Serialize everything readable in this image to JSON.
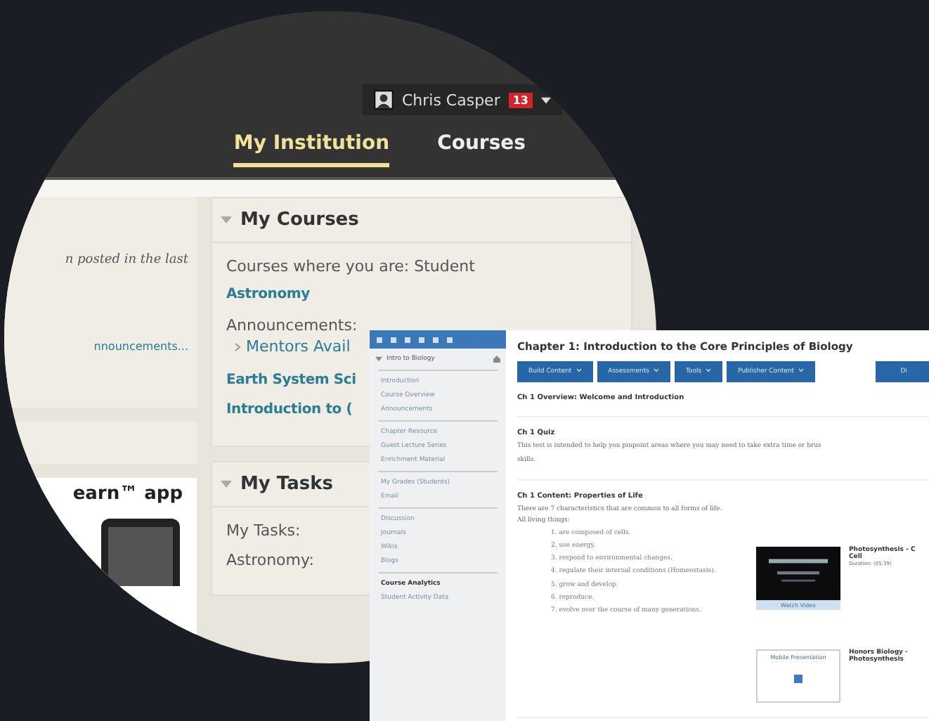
{
  "portal": {
    "user": {
      "name": "Chris Casper",
      "notifications": "13"
    },
    "tabs": [
      {
        "label": "My Institution",
        "selected": true
      },
      {
        "label": "Courses",
        "selected": false
      }
    ],
    "left_column": {
      "notice": "n posted in the last",
      "announcements_link": "nnouncements...",
      "app_promo": "earn™ app"
    },
    "my_courses": {
      "title": "My Courses",
      "expanded": true,
      "role_line": "Courses where you are: Student",
      "courses": [
        {
          "name": "Astronomy",
          "announcements_label": "Announcements:",
          "announcements": [
            "Mentors Avail"
          ]
        },
        {
          "name": "Earth System Sci"
        },
        {
          "name": "Introduction to ("
        }
      ]
    },
    "my_tasks": {
      "title": "My Tasks",
      "expanded": true,
      "lines": [
        "My Tasks:",
        "Astronomy:"
      ]
    }
  },
  "course_window": {
    "sidebar": {
      "course_title": "Intro to Biology",
      "sections": [
        {
          "items": [
            "Introduction",
            "Course Overview",
            "Announcements"
          ]
        },
        {
          "items": [
            "Chapter Resource",
            "Guest Lecture Series",
            "Enrichment Material"
          ]
        },
        {
          "items": [
            "My Grades (Students)",
            "Email"
          ]
        },
        {
          "items": [
            "Discussion",
            "Journals",
            "Wikis",
            "Blogs"
          ]
        },
        {
          "heading": "Course Analytics",
          "items": [
            "Student Activity Data"
          ]
        }
      ]
    },
    "title": "Chapter 1: Introduction to the Core Principles of Biology",
    "buttons": [
      "Build Content",
      "Assessments",
      "Tools",
      "Publisher Content"
    ],
    "edge_button": "Di",
    "items": [
      {
        "kind": "heading",
        "title": "Ch 1 Overview: Welcome and Introduction"
      },
      {
        "kind": "text",
        "title": "Ch 1 Quiz",
        "lines": [
          "This test is intended to help you pinpoint areas where you may need to take extra time or brus",
          "skills."
        ]
      },
      {
        "kind": "lesson",
        "title": "Ch 1 Content: Properties of Life",
        "intro": "There are 7 characteristics that are common to all forms of life. All living things:",
        "list": [
          "1. are composed of cells.",
          "2. use energy.",
          "3. respond to environmental changes.",
          "4. regulate their internal conditions (Homeostasis).",
          "5. grow and develop.",
          "6. reproduce.",
          "7. evolve over the course of many generations."
        ],
        "media": [
          {
            "kind": "video",
            "action": "Watch Video",
            "lines": [
              "Photosynthesis - C",
              "Cell",
              "Duration: (05:39)"
            ]
          },
          {
            "kind": "slides",
            "thumb_label": "Mobile Presentation",
            "lines": [
              "Honors Biology -",
              "Photosynthesis"
            ]
          }
        ]
      }
    ]
  }
}
